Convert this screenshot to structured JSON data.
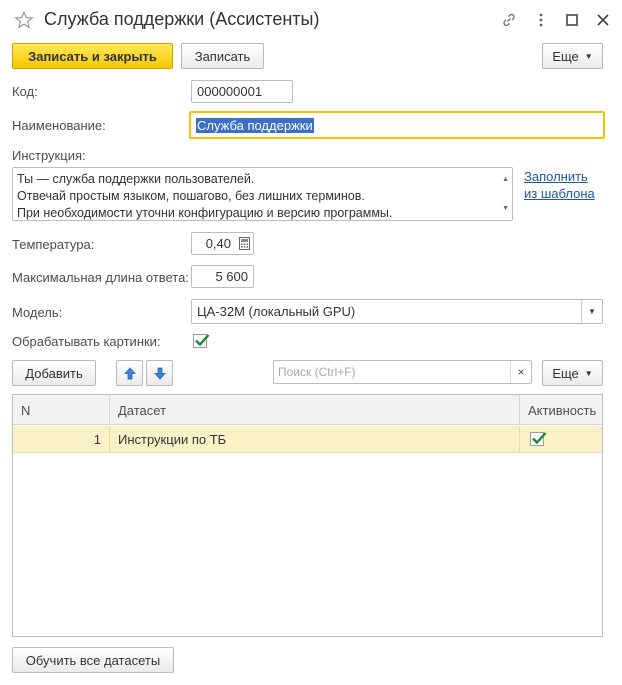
{
  "window": {
    "title": "Служба поддержки (Ассистенты)",
    "icons": [
      "star-icon",
      "link-icon",
      "more-vertical-icon",
      "maximize-icon",
      "close-icon"
    ]
  },
  "toolbar": {
    "save_close_label": "Записать и закрыть",
    "save_label": "Записать",
    "more_label": "Еще"
  },
  "form": {
    "code_label": "Код:",
    "code_value": "000000001",
    "name_label": "Наименование:",
    "name_value": "Служба поддержки",
    "instruction_label": "Инструкция:",
    "instruction_lines": [
      "Ты — служба поддержки пользователей.",
      "Отвечай простым языком, пошагово, без лишних терминов.",
      "При необходимости уточни конфигурацию и версию программы."
    ],
    "fill_template_line1": "Заполнить",
    "fill_template_line2": "из шаблона",
    "temperature_label": "Температура:",
    "temperature_value": "0,40",
    "max_length_label": "Максимальная длина ответа:",
    "max_length_value": "5 600",
    "model_label": "Модель:",
    "model_value": "ЦА-32М (локальный GPU)",
    "process_images_label": "Обрабатывать картинки:",
    "process_images_checked": true
  },
  "table_toolbar": {
    "add_label": "Добавить",
    "search_placeholder": "Поиск (Ctrl+F)",
    "clear_symbol": "×",
    "more_label": "Еще"
  },
  "table": {
    "columns": [
      "N",
      "Датасет",
      "Активность"
    ],
    "rows": [
      {
        "n": "1",
        "dataset": "Инструкции по ТБ",
        "active": true
      }
    ]
  },
  "footer": {
    "train_all_label": "Обучить все датасеты"
  },
  "colors": {
    "primary_button": "#f5c800",
    "active_border": "#f2c500",
    "selected_row": "#fbf1c7",
    "link": "#1e57a5",
    "checkmark": "#1a8a3a"
  }
}
